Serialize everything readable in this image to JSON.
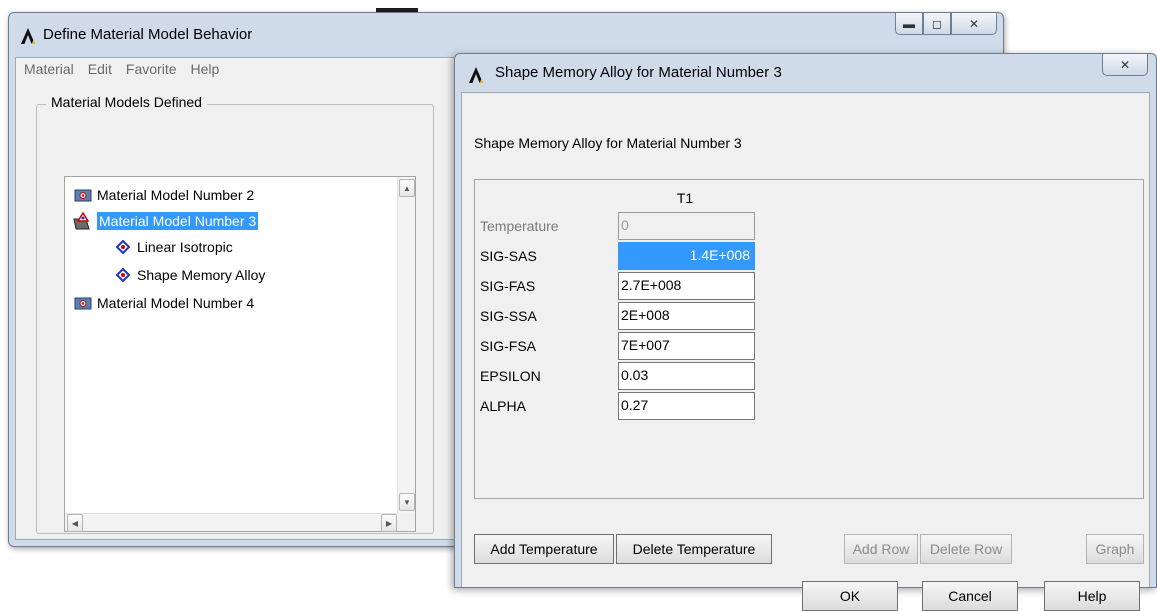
{
  "main_window": {
    "title": "Define Material Model Behavior",
    "menu": [
      "Material",
      "Edit",
      "Favorite",
      "Help"
    ],
    "group_label": "Material Models Defined",
    "tree": [
      {
        "label": "Material Model Number 2",
        "icon": "material-folder-icon",
        "selected": false
      },
      {
        "label": "Material Model Number 3",
        "icon": "material-folder-open-icon",
        "selected": true
      },
      {
        "label": "Linear Isotropic",
        "icon": "property-diamond-icon",
        "selected": false
      },
      {
        "label": "Shape Memory Alloy",
        "icon": "property-diamond-icon",
        "selected": false
      },
      {
        "label": "Material Model Number 4",
        "icon": "material-folder-icon",
        "selected": false
      }
    ]
  },
  "dialog": {
    "title": "Shape Memory Alloy  for Material Number 3",
    "heading": "Shape Memory Alloy  for Material Number 3",
    "column_header": "T1",
    "rows": [
      {
        "label": "Temperature",
        "value": "0",
        "state": "disabled"
      },
      {
        "label": "SIG-SAS",
        "value": "1.4E+008",
        "state": "selected"
      },
      {
        "label": "SIG-FAS",
        "value": "2.7E+008",
        "state": "normal"
      },
      {
        "label": "SIG-SSA",
        "value": "2E+008",
        "state": "normal"
      },
      {
        "label": "SIG-FSA",
        "value": "7E+007",
        "state": "normal"
      },
      {
        "label": "EPSILON",
        "value": "0.03",
        "state": "normal"
      },
      {
        "label": "ALPHA",
        "value": "0.27",
        "state": "normal"
      }
    ],
    "buttons": {
      "add_temperature": "Add Temperature",
      "delete_temperature": "Delete Temperature",
      "add_row": "Add Row",
      "delete_row": "Delete Row",
      "graph": "Graph",
      "ok": "OK",
      "cancel": "Cancel",
      "help": "Help"
    }
  },
  "colors": {
    "selection": "#3399ff",
    "window_frame": "#cfdbe9",
    "client_bg": "#f0f0f0"
  }
}
